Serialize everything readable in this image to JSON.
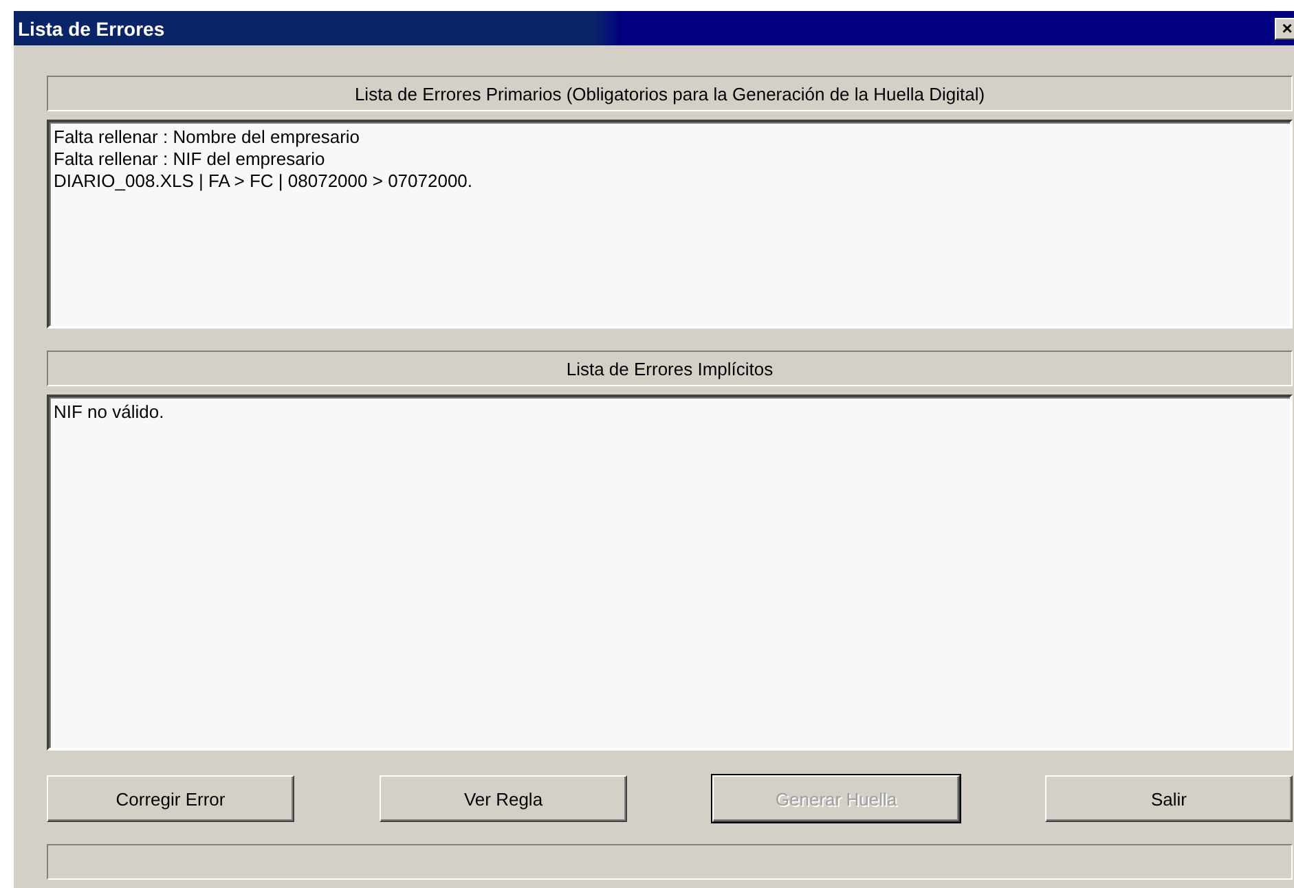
{
  "window": {
    "title": "Lista de Errores",
    "close": "×"
  },
  "primary": {
    "heading": "Lista de Errores Primarios (Obligatorios para la Generación de la Huella Digital)",
    "lines": [
      "Falta rellenar : Nombre del empresario",
      "Falta rellenar : NIF del empresario",
      "DIARIO_008.XLS | FA > FC | 08072000 > 07072000."
    ]
  },
  "implicit": {
    "heading": "Lista de Errores Implícitos",
    "lines": [
      "NIF no válido."
    ]
  },
  "buttons": [
    {
      "label": "Corregir Error",
      "disabled": false,
      "default": false
    },
    {
      "label": "Ver Regla",
      "disabled": false,
      "default": false
    },
    {
      "label": "Generar Huella",
      "disabled": true,
      "default": true
    },
    {
      "label": "Salir",
      "disabled": false,
      "default": false
    }
  ]
}
